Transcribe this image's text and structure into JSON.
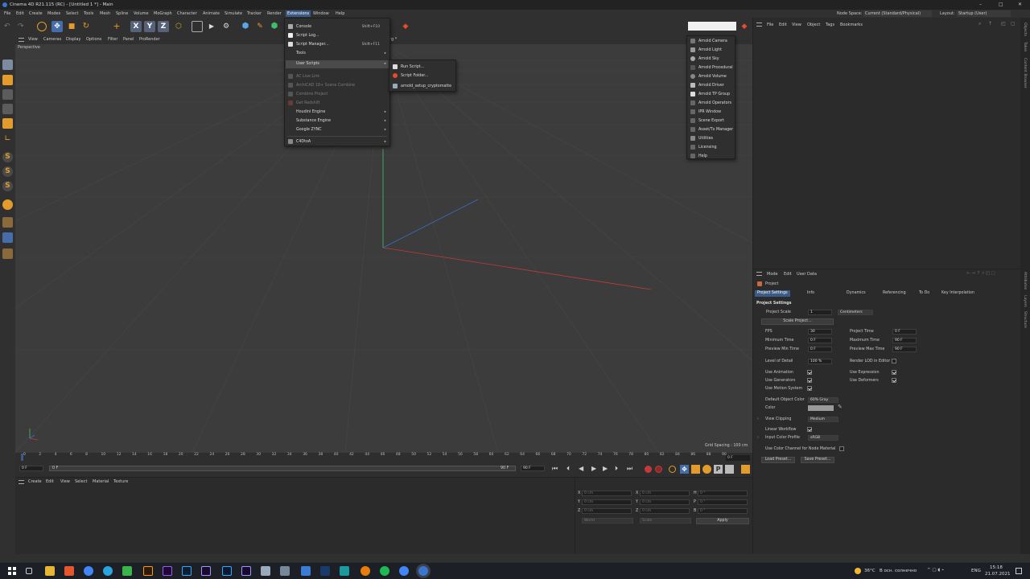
{
  "window": {
    "title": "Cinema 4D R21.115 (RC) - [Untitled 1 *] - Main",
    "controls": [
      "–",
      "□",
      "✕"
    ]
  },
  "menubar": {
    "items": [
      "File",
      "Edit",
      "Create",
      "Modes",
      "Select",
      "Tools",
      "Mesh",
      "Spline",
      "Volume",
      "MoGraph",
      "Character",
      "Animate",
      "Simulate",
      "Tracker",
      "Render",
      "Extensions",
      "Window",
      "Help"
    ],
    "active": "Extensions",
    "node_space_label": "Node Space:",
    "node_space_value": "Current (Standard/Physical)",
    "layout_label": "Layout:",
    "layout_value": "Startup (User)"
  },
  "viewport": {
    "menu": [
      "View",
      "Cameras",
      "Display",
      "Options",
      "Filter",
      "Panel",
      "ProRender"
    ],
    "name": "Perspective",
    "grid_spacing": "Grid Spacing : 100 cm",
    "obscured_title": "rg *"
  },
  "extensions_menu": {
    "items": [
      {
        "label": "Console",
        "shortcut": "Shift+F10",
        "enabled": true
      },
      {
        "label": "Script Log...",
        "shortcut": "",
        "enabled": true
      },
      {
        "label": "Script Manager...",
        "shortcut": "Shift+F11",
        "enabled": true
      },
      {
        "label": "Tools",
        "shortcut": "",
        "enabled": true,
        "submenu": true
      },
      {
        "label": "User Scripts",
        "shortcut": "",
        "enabled": true,
        "submenu": true,
        "highlighted": true
      },
      {
        "label": "AC Live Link",
        "shortcut": "",
        "enabled": false
      },
      {
        "label": "ArchiCAD 18+ Scene Combine",
        "shortcut": "",
        "enabled": false
      },
      {
        "label": "Combine Project",
        "shortcut": "",
        "enabled": false
      },
      {
        "label": "Get Redshift",
        "shortcut": "",
        "enabled": false
      },
      {
        "label": "Houdini Engine",
        "shortcut": "",
        "enabled": true,
        "submenu": true
      },
      {
        "label": "Substance Engine",
        "shortcut": "",
        "enabled": true,
        "submenu": true
      },
      {
        "label": "Google ZYNC",
        "shortcut": "",
        "enabled": true,
        "submenu": true
      },
      {
        "label": "C4DtoA",
        "shortcut": "",
        "enabled": true,
        "submenu": true
      }
    ]
  },
  "user_scripts_menu": {
    "items": [
      "Run Script...",
      "Script Folder...",
      "arnold_setup_cryptomatte"
    ]
  },
  "arnold_menu": {
    "items": [
      "Arnold Camera",
      "Arnold Light",
      "Arnold Sky",
      "Arnold Procedural",
      "Arnold Volume",
      "Arnold Driver",
      "Arnold TP Group",
      "Arnold Operators",
      "IPR Window",
      "Scene Export",
      "Asset/Tx Manager",
      "Utilities",
      "Licensing",
      "Help"
    ]
  },
  "object_manager": {
    "menu": [
      "File",
      "Edit",
      "View",
      "Object",
      "Tags",
      "Bookmarks"
    ]
  },
  "attributes": {
    "menu": [
      "Mode",
      "Edit",
      "User Data"
    ],
    "object": "Project",
    "tabs": [
      "Project Settings",
      "Info",
      "Dynamics",
      "Referencing",
      "To Do",
      "Key Interpolation"
    ],
    "active_tab": "Project Settings",
    "section": "Project Settings",
    "project_scale_label": "Project Scale",
    "project_scale_value": "1",
    "project_scale_unit": "Centimeters",
    "scale_project_btn": "Scale Project...",
    "fps_label": "FPS",
    "fps_value": "30",
    "project_time_label": "Project Time",
    "project_time_value": "0 F",
    "min_time_label": "Minimum Time",
    "min_time_value": "0 F",
    "max_time_label": "Maximum Time",
    "max_time_value": "90 F",
    "preview_min_label": "Preview Min Time",
    "preview_min_value": "0 F",
    "preview_max_label": "Preview Max Time",
    "preview_max_value": "90 F",
    "lod_label": "Level of Detail",
    "lod_value": "100 %",
    "render_lod_label": "Render LOD in Editor",
    "use_animation": "Use Animation",
    "use_expression": "Use Expression",
    "use_generators": "Use Generators",
    "use_deformers": "Use Deformers",
    "use_motion": "Use Motion System",
    "default_color_label": "Default Object Color",
    "default_color_value": "60% Gray",
    "color_label": "Color",
    "view_clipping_label": "View Clipping",
    "view_clipping_value": "Medium",
    "linear_workflow": "Linear Workflow",
    "input_color_label": "Input Color Profile",
    "input_color_value": "sRGB",
    "color_channel_label": "Use Color Channel for Node Material",
    "load_preset": "Load Preset...",
    "save_preset": "Save Preset..."
  },
  "timeline": {
    "ticks": [
      "0",
      "2",
      "4",
      "6",
      "8",
      "10",
      "12",
      "14",
      "16",
      "18",
      "20",
      "22",
      "24",
      "26",
      "28",
      "30",
      "32",
      "34",
      "36",
      "38",
      "40",
      "42",
      "44",
      "46",
      "48",
      "50",
      "52",
      "54",
      "56",
      "58",
      "60",
      "62",
      "64",
      "66",
      "68",
      "70",
      "72",
      "74",
      "76",
      "78",
      "80",
      "82",
      "84",
      "86",
      "88",
      "90"
    ],
    "current_frame": "0 F",
    "start": "0 F",
    "slider_start": "0 F",
    "slider_end": "90 F",
    "end": "90 F"
  },
  "material_manager": {
    "menu": [
      "Create",
      "Edit",
      "View",
      "Select",
      "Material",
      "Texture"
    ]
  },
  "coordinates": {
    "rows": [
      [
        "X",
        "0 cm",
        "X",
        "0 cm",
        "H",
        "0 °"
      ],
      [
        "Y",
        "0 cm",
        "Y",
        "0 cm",
        "P",
        "0 °"
      ],
      [
        "Z",
        "0 cm",
        "Z",
        "0 cm",
        "B",
        "0 °"
      ]
    ],
    "mode1": "World",
    "mode2": "Scale",
    "apply": "Apply"
  },
  "right_tabs": [
    "Objects",
    "Takes",
    "Content Browser"
  ],
  "right_tabs2": [
    "Attributes",
    "Layers",
    "Structure"
  ],
  "taskbar": {
    "weather": "36°C",
    "weather_text": "В осн. солнечно",
    "lang": "ENG",
    "time": "15:18",
    "date": "21.07.2021"
  },
  "colors": {
    "accent": "#3b5a85",
    "x_axis": "#c43a3a",
    "y_axis": "#3ec06a",
    "z_axis": "#3a6ec4",
    "bg": "#2b2b2b"
  }
}
